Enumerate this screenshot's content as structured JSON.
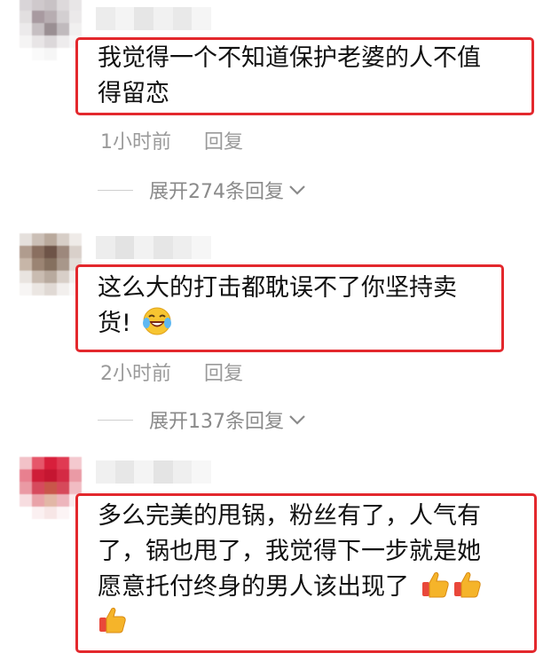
{
  "comments": [
    {
      "text_lines": [
        "我觉得一个不知道保护老婆的人不值",
        "得留恋"
      ],
      "time": "1小时前",
      "reply_label": "回复",
      "expand_label": "展开274条回复"
    },
    {
      "text_lines": [
        "这么大的打击都耽误不了你坚持卖",
        "货!"
      ],
      "emoji": "laughing-tears-emoji",
      "time": "2小时前",
      "reply_label": "回复",
      "expand_label": "展开137条回复"
    },
    {
      "text_lines": [
        "多么完美的甩锅，粉丝有了，人气有",
        "了，锅也甩了，我觉得下一步就是她",
        "愿意托付终身的男人该出现了"
      ],
      "emoji": "thumbs-up-emoji"
    }
  ],
  "colors": {
    "highlight_border": "#e3282d",
    "meta_text": "#9a9a9a",
    "body_text": "#111111"
  }
}
